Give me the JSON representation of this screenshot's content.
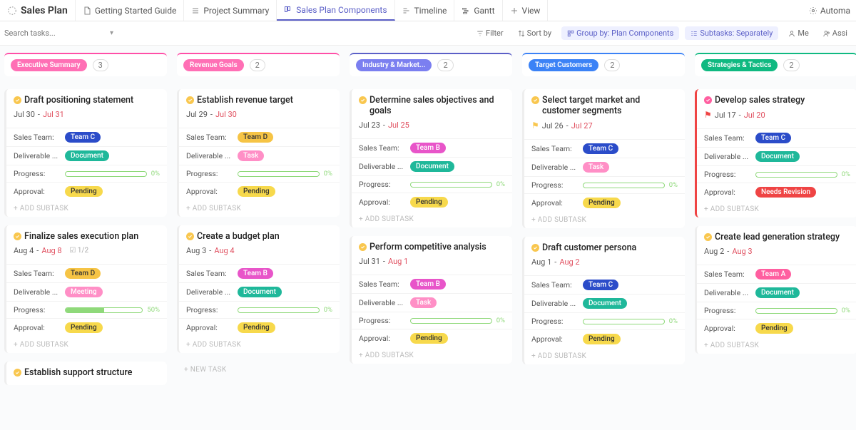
{
  "header": {
    "page_title": "Sales Plan",
    "tabs": [
      {
        "label": "Getting Started Guide",
        "icon": "doc-icon",
        "active": false
      },
      {
        "label": "Project Summary",
        "icon": "list-icon",
        "active": false
      },
      {
        "label": "Sales Plan Components",
        "icon": "board-icon",
        "active": true
      },
      {
        "label": "Timeline",
        "icon": "timeline-icon",
        "active": false
      },
      {
        "label": "Gantt",
        "icon": "gantt-icon",
        "active": false
      },
      {
        "label": "View",
        "icon": "plus-icon",
        "active": false
      }
    ],
    "automation_label": "Automa"
  },
  "toolbar": {
    "search_placeholder": "Search tasks...",
    "filter_label": "Filter",
    "sort_label": "Sort by",
    "group_label": "Group by: Plan Components",
    "subtasks_label": "Subtasks: Separately",
    "me_label": "Me",
    "assign_label": "Assi"
  },
  "columns": [
    {
      "title": "Executive Summary",
      "count": "3",
      "cards": [
        {
          "title": "Draft positioning statement",
          "status": "yellow",
          "date_start": "Jul 30",
          "date_end": "Jul 31",
          "team": "Team C",
          "team_class": "team-c",
          "deliverable": "Document",
          "deliverable_class": "deliv-document",
          "progress": 0,
          "progress_label": "0%",
          "approval": "Pending",
          "approval_class": "appr-pending"
        },
        {
          "title": "Finalize sales execution plan",
          "status": "yellow",
          "date_start": "Aug 4",
          "date_end": "Aug 8",
          "checklist": "1/2",
          "team": "Team D",
          "team_class": "team-d",
          "deliverable": "Meeting",
          "deliverable_class": "deliv-meeting",
          "progress": 50,
          "progress_label": "50%",
          "approval": "Pending",
          "approval_class": "appr-pending"
        },
        {
          "title": "Establish support structure",
          "status": "yellow",
          "partial": true
        }
      ]
    },
    {
      "title": "Revenue Goals",
      "count": "2",
      "cards": [
        {
          "title": "Establish revenue target",
          "status": "yellow",
          "date_start": "Jul 29",
          "date_end": "Jul 30",
          "team": "Team D",
          "team_class": "team-d",
          "deliverable": "Task",
          "deliverable_class": "deliv-task",
          "progress": 0,
          "progress_label": "0%",
          "approval": "Pending",
          "approval_class": "appr-pending"
        },
        {
          "title": "Create a budget plan",
          "status": "yellow",
          "date_start": "Aug 3",
          "date_end": "Aug 4",
          "team": "Team B",
          "team_class": "team-b",
          "deliverable": "Document",
          "deliverable_class": "deliv-document",
          "progress": 0,
          "progress_label": "0%",
          "approval": "Pending",
          "approval_class": "appr-pending"
        }
      ],
      "new_task": true
    },
    {
      "title": "Industry & Market...",
      "count": "2",
      "cards": [
        {
          "title": "Determine sales objectives and goals",
          "status": "yellow",
          "date_start": "Jul 23",
          "date_end": "Jul 25",
          "team": "Team B",
          "team_class": "team-b",
          "deliverable": "Document",
          "deliverable_class": "deliv-document",
          "progress": 0,
          "progress_label": "0%",
          "approval": "Pending",
          "approval_class": "appr-pending"
        },
        {
          "title": "Perform competitive analysis",
          "status": "yellow",
          "date_start": "Jul 31",
          "date_end": "Aug 1",
          "team": "Team B",
          "team_class": "team-b",
          "deliverable": "Task",
          "deliverable_class": "deliv-task",
          "progress": 0,
          "progress_label": "0%",
          "approval": "Pending",
          "approval_class": "appr-pending"
        }
      ]
    },
    {
      "title": "Target Customers",
      "count": "2",
      "cards": [
        {
          "title": "Select target market and customer segments",
          "status": "yellow",
          "flag": "yellow",
          "date_start": "Jul 26",
          "date_end": "Jul 27",
          "team": "Team C",
          "team_class": "team-c",
          "deliverable": "Task",
          "deliverable_class": "deliv-task",
          "progress": 0,
          "progress_label": "0%",
          "approval": "Pending",
          "approval_class": "appr-pending"
        },
        {
          "title": "Draft customer persona",
          "status": "yellow",
          "date_start": "Aug 1",
          "date_end": "Aug 2",
          "team": "Team C",
          "team_class": "team-c",
          "deliverable": "Document",
          "deliverable_class": "deliv-document",
          "progress": 0,
          "progress_label": "0%",
          "approval": "Pending",
          "approval_class": "appr-pending"
        }
      ]
    },
    {
      "title": "Strategies & Tactics",
      "count": "2",
      "cards": [
        {
          "title": "Develop sales strategy",
          "status": "pink",
          "flag": "red",
          "flagged_border": true,
          "date_start": "Jul 17",
          "date_end": "Jul 20",
          "team": "Team C",
          "team_class": "team-c",
          "deliverable": "Document",
          "deliverable_class": "deliv-document",
          "progress": 0,
          "progress_label": "0%",
          "approval": "Needs Revision",
          "approval_class": "appr-revision"
        },
        {
          "title": "Create lead generation strategy",
          "status": "yellow",
          "date_start": "Aug 2",
          "date_end": "Aug 3",
          "team": "Team A",
          "team_class": "team-a",
          "deliverable": "Document",
          "deliverable_class": "deliv-document",
          "progress": 0,
          "progress_label": "0%",
          "approval": "Pending",
          "approval_class": "appr-pending"
        }
      ]
    }
  ],
  "labels": {
    "sales_team": "Sales Team:",
    "deliverable": "Deliverable ...",
    "progress": "Progress:",
    "approval": "Approval:",
    "add_subtask": "+ ADD SUBTASK",
    "new_task": "+ NEW TASK"
  }
}
